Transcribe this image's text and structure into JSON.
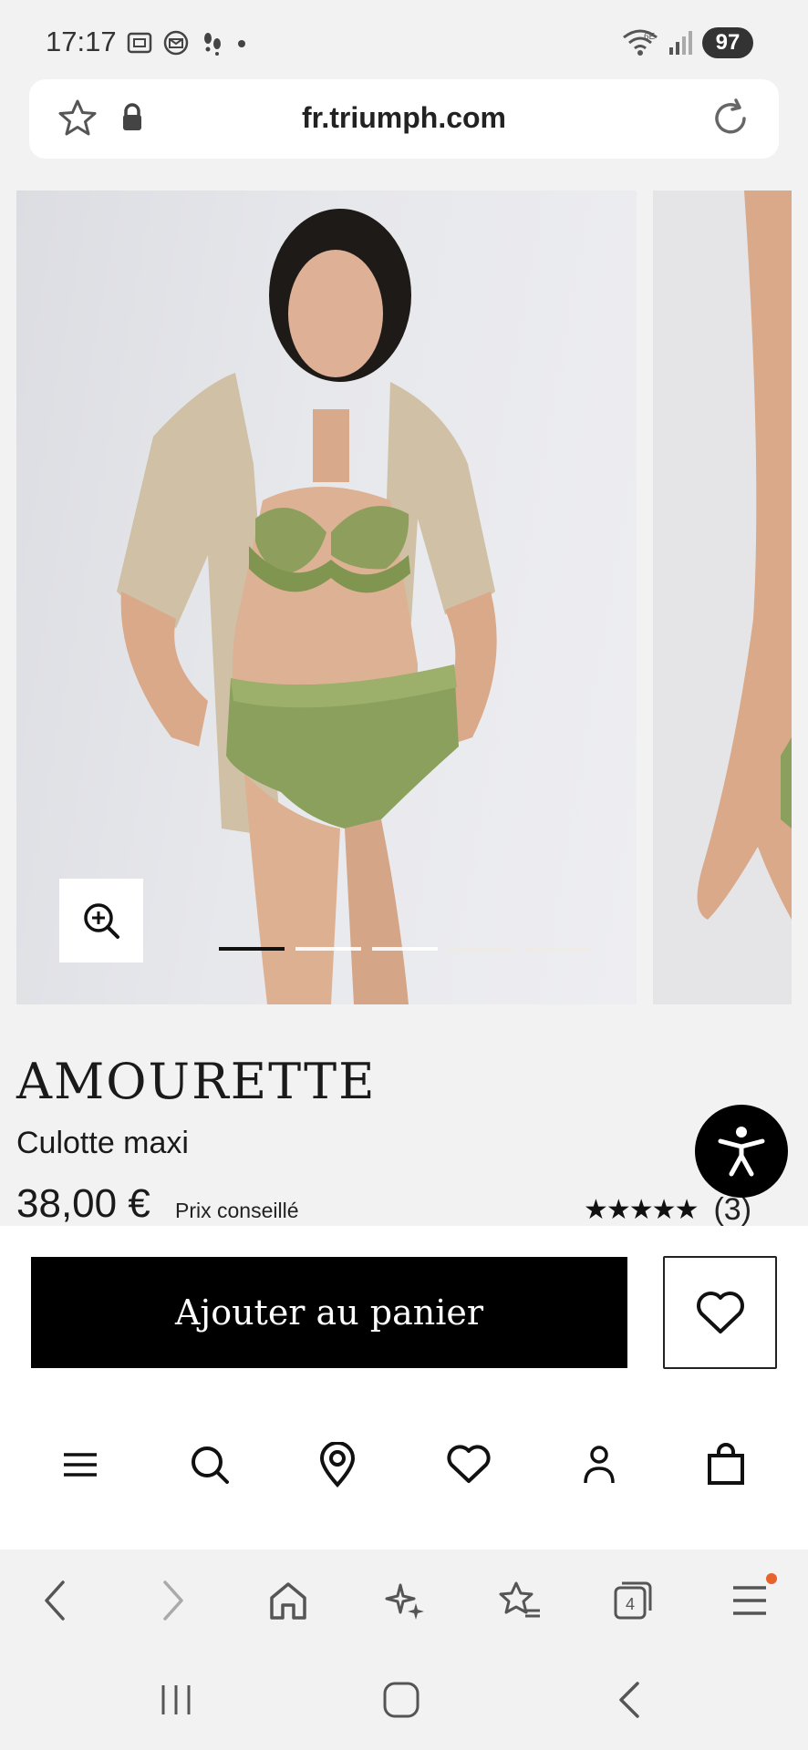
{
  "status_bar": {
    "time": "17:17",
    "network": "6E",
    "battery": "97"
  },
  "url_bar": {
    "domain": "fr.triumph.com"
  },
  "gallery": {
    "total_slides": 5,
    "active_slide": 1
  },
  "product": {
    "brand": "AMOURETTE",
    "name": "Culotte maxi",
    "price": "38,00 €",
    "price_note": "Prix conseillé",
    "rating": 5,
    "review_count": "(3)"
  },
  "actions": {
    "add_to_cart": "Ajouter au panier"
  },
  "site_nav": {
    "items": [
      "menu-icon",
      "search-icon",
      "store-locator-icon",
      "wishlist-icon",
      "account-icon",
      "bag-icon"
    ]
  },
  "browser_toolbar": {
    "tabs_count": "4"
  },
  "colors": {
    "accent": "#000000",
    "notification": "#e8622c",
    "product": "#8aa05c"
  }
}
